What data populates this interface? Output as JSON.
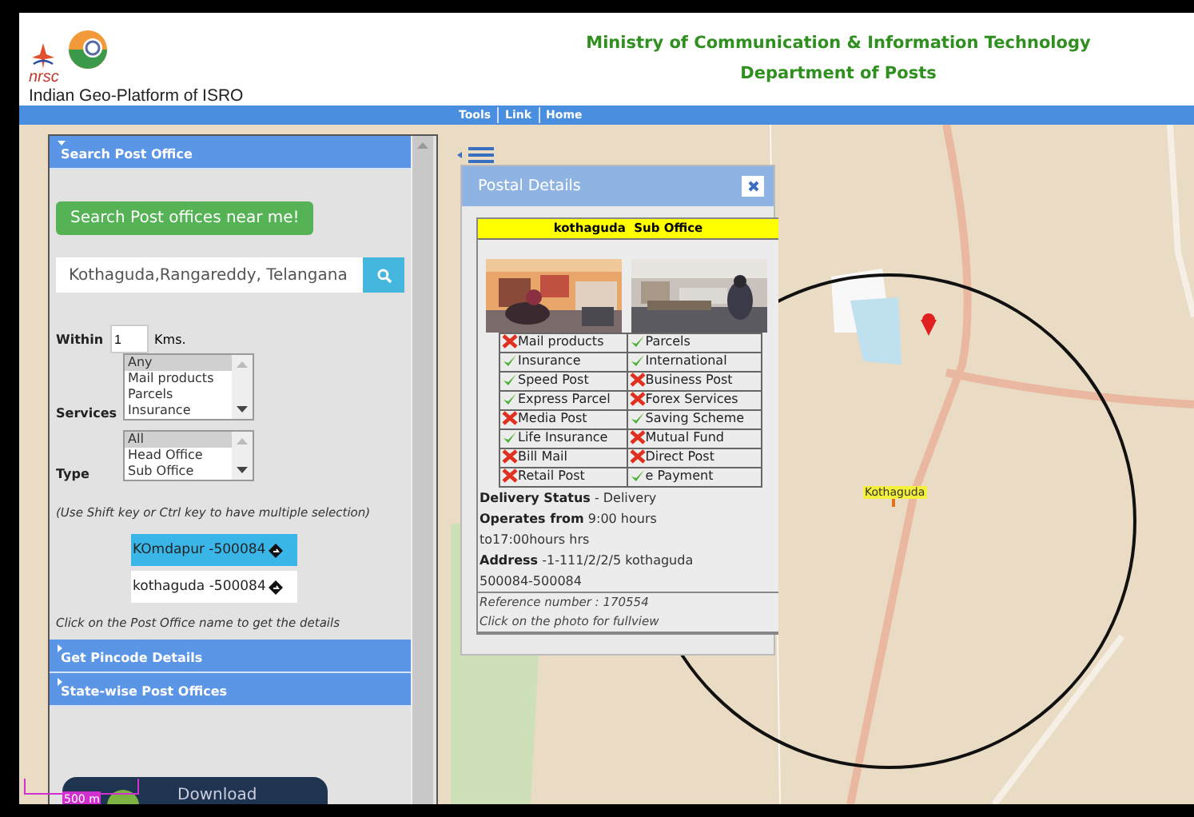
{
  "header": {
    "org_label": "nrsc",
    "platform_name": "Indian Geo-Platform of ISRO",
    "title": "Ministry of Communication & Information Technology",
    "subtitle": "Department of Posts"
  },
  "nav": [
    {
      "label": "Tools"
    },
    {
      "label": "Link"
    },
    {
      "label": "Home"
    }
  ],
  "sidebar": {
    "sections": [
      {
        "title": "Search Post Office",
        "expanded": true
      },
      {
        "title": "Get Pincode Details",
        "expanded": false
      },
      {
        "title": "State-wise Post Offices",
        "expanded": false
      }
    ],
    "near_me_button": "Search Post offices near me!",
    "search": {
      "value": "Kothaguda,Rangareddy, Telangana"
    },
    "within": {
      "label": "Within",
      "value": "1",
      "unit": "Kms."
    },
    "services": {
      "label": "Services",
      "options": [
        {
          "label": "Any",
          "selected": true
        },
        {
          "label": "Mail products",
          "selected": false
        },
        {
          "label": "Parcels",
          "selected": false
        },
        {
          "label": "Insurance",
          "selected": false
        }
      ]
    },
    "type": {
      "label": "Type",
      "options": [
        {
          "label": "All",
          "selected": true
        },
        {
          "label": "Head Office",
          "selected": false
        },
        {
          "label": "Sub Office",
          "selected": false
        }
      ]
    },
    "hint": "(Use Shift key or Ctrl key to have multiple selection)",
    "results": [
      {
        "label": "KOmdapur -500084",
        "selected": true
      },
      {
        "label": "kothaguda -500084",
        "selected": false
      }
    ],
    "results_hint": "Click on the Post Office name to get the details",
    "download_button": "Download"
  },
  "map": {
    "scale": "500 m",
    "marker_label": "Kothaguda"
  },
  "popup": {
    "title": "Postal Details",
    "office": "kothaguda  Sub Office",
    "services": [
      {
        "label": "Mail products",
        "available": false
      },
      {
        "label": "Parcels",
        "available": true
      },
      {
        "label": "Insurance",
        "available": true
      },
      {
        "label": "International",
        "available": true
      },
      {
        "label": "Speed Post",
        "available": true
      },
      {
        "label": "Business Post",
        "available": false
      },
      {
        "label": "Express Parcel",
        "available": true
      },
      {
        "label": "Forex Services",
        "available": false
      },
      {
        "label": "Media Post",
        "available": false
      },
      {
        "label": "Saving Scheme",
        "available": true
      },
      {
        "label": "Life Insurance",
        "available": true
      },
      {
        "label": "Mutual Fund",
        "available": false
      },
      {
        "label": "Bill Mail",
        "available": false
      },
      {
        "label": "Direct Post",
        "available": false
      },
      {
        "label": "Retail Post",
        "available": false
      },
      {
        "label": "e Payment",
        "available": true
      }
    ],
    "details": [
      "**Delivery Status** - Delivery",
      "**Operates from** 9:00 hours to17:00hours hrs",
      "**Address** -1-111/2/2/5 kothaguda 500084-500084"
    ],
    "reference": "Reference number : 170554",
    "photo_hint": "Click on the photo for fullview"
  }
}
